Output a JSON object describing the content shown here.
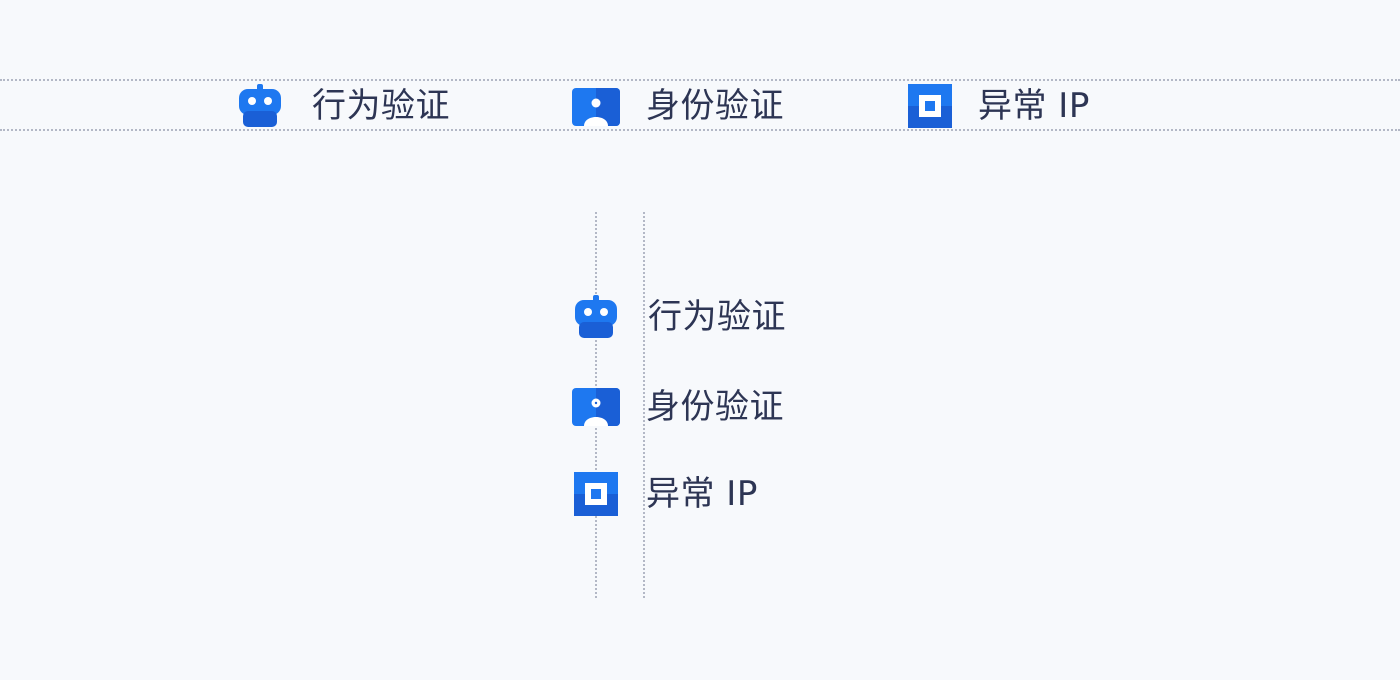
{
  "horizontal_row": {
    "items": [
      {
        "icon": "robot-icon",
        "label": "行为验证"
      },
      {
        "icon": "id-card-icon",
        "label": "身份验证"
      },
      {
        "icon": "square-ip-icon",
        "label": "异常 IP"
      }
    ]
  },
  "vertical_column": {
    "items": [
      {
        "icon": "robot-icon",
        "label": "行为验证"
      },
      {
        "icon": "id-card-icon",
        "label": "身份验证"
      },
      {
        "icon": "square-ip-icon",
        "label": "异常 IP"
      }
    ]
  },
  "colors": {
    "background": "#f7f9fc",
    "icon_blue": "#1e78f0",
    "icon_blue_dark": "#1a5fd6",
    "text": "#2d3554",
    "guide": "#b3b8c6"
  }
}
